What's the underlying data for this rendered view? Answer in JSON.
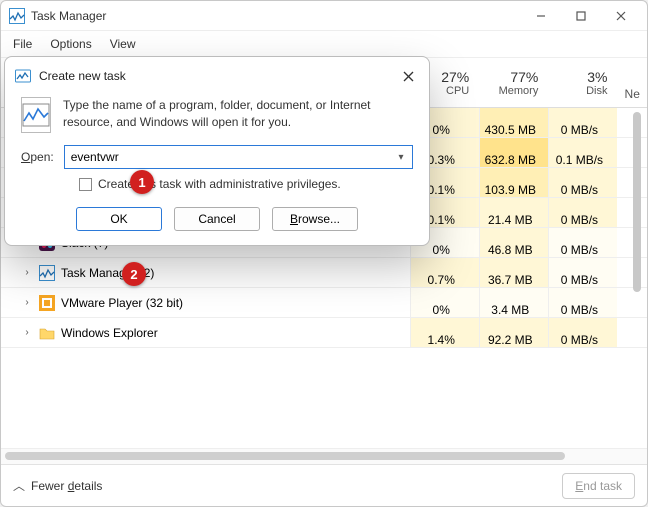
{
  "window": {
    "title": "Task Manager"
  },
  "menus": [
    "File",
    "Options",
    "View"
  ],
  "columns": {
    "cpu": {
      "pct": "27%",
      "label": "CPU"
    },
    "memory": {
      "pct": "77%",
      "label": "Memory"
    },
    "disk": {
      "pct": "3%",
      "label": "Disk"
    },
    "extra": "Ne"
  },
  "rows": [
    {
      "label": "",
      "cpu": "0%",
      "mem": "430.5 MB",
      "disk": "0 MB/s",
      "shades": [
        "shade1",
        "shade2",
        "shade1"
      ]
    },
    {
      "label": "",
      "cpu": "0.3%",
      "mem": "632.8 MB",
      "disk": "0.1 MB/s",
      "shades": [
        "shade1",
        "shade3",
        "shade1"
      ]
    },
    {
      "label": "",
      "cpu": "0.1%",
      "mem": "103.9 MB",
      "disk": "0 MB/s",
      "shades": [
        "shade1",
        "shade2",
        "shade1"
      ]
    },
    {
      "label": "",
      "cpu": "0.1%",
      "mem": "21.4 MB",
      "disk": "0 MB/s",
      "shades": [
        "shade1",
        "shade1",
        "shade1"
      ]
    },
    {
      "type": "app",
      "icon": "slack",
      "label": "Slack (7)",
      "cpu": "0%",
      "mem": "46.8 MB",
      "disk": "0 MB/s",
      "shades": [
        "shade0",
        "shade1",
        "shade0"
      ]
    },
    {
      "type": "app",
      "icon": "tm",
      "label": "Task Manager (2)",
      "cpu": "0.7%",
      "mem": "36.7 MB",
      "disk": "0 MB/s",
      "shades": [
        "shade1",
        "shade1",
        "shade0"
      ]
    },
    {
      "type": "app",
      "icon": "vmware",
      "label": "VMware Player (32 bit)",
      "cpu": "0%",
      "mem": "3.4 MB",
      "disk": "0 MB/s",
      "shades": [
        "shade0",
        "shade0",
        "shade0"
      ]
    },
    {
      "type": "app",
      "icon": "explorer",
      "label": "Windows Explorer",
      "cpu": "1.4%",
      "mem": "92.2 MB",
      "disk": "0 MB/s",
      "shades": [
        "shade1",
        "shade1",
        "shade1"
      ]
    }
  ],
  "footer": {
    "fewer": "Fewer details",
    "fewer_underline": "d",
    "end_task": "End task",
    "end_task_underline": "E"
  },
  "dialog": {
    "title": "Create new task",
    "desc": "Type the name of a program, folder, document, or Internet resource, and Windows will open it for you.",
    "open_label": "Open:",
    "open_value": "eventvwr",
    "checkbox": "Create this task with administrative privileges.",
    "ok": "OK",
    "cancel": "Cancel",
    "browse": "Browse..."
  },
  "annotations": {
    "a1": "1",
    "a2": "2"
  }
}
